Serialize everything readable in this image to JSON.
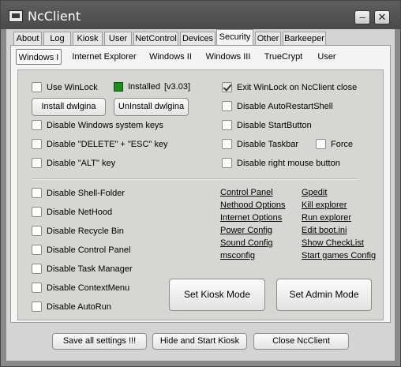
{
  "window": {
    "title": "NcClient",
    "minimize": "–",
    "close": "✕"
  },
  "tabs": [
    "About",
    "Log",
    "Kiosk",
    "User",
    "NetControl",
    "Devices",
    "Security",
    "Other",
    "Barkeeper"
  ],
  "subtabs": [
    "Windows I",
    "Internet Explorer",
    "Windows II",
    "Windows III",
    "TrueCrypt",
    "User"
  ],
  "winlock": {
    "use_label": "Use WinLock",
    "status_label": "Installed",
    "version": "[v3.03]",
    "status_color": "#1f8a1f",
    "install_button": "Install dwlgina",
    "uninstall_button": "UnInstall dwlgina",
    "exit_label": "Exit WinLock on NcClient close"
  },
  "left_options": [
    "Disable Windows system keys",
    "Disable \"DELETE\" + \"ESC\" key",
    "Disable \"ALT\" key"
  ],
  "right_options": {
    "auto_restart": "Disable AutoRestartShell",
    "start_button": "Disable StartButton",
    "taskbar": "Disable Taskbar",
    "force": "Force",
    "right_mouse": "Disable right mouse button"
  },
  "lower_options": [
    "Disable Shell-Folder",
    "Disable NetHood",
    "Disable Recycle Bin",
    "Disable Control Panel",
    "Disable Task Manager",
    "Disable ContextMenu",
    "Disable AutoRun"
  ],
  "links_col1": [
    "Control Panel",
    "Nethood Options",
    "Internet Options",
    "Power Config",
    "Sound Config",
    "msconfig"
  ],
  "links_col2": [
    "Gpedit",
    "Kill explorer",
    "Run explorer",
    "Edit boot.ini",
    "Show CheckList",
    "Start games Config"
  ],
  "mode_buttons": {
    "kiosk": "Set Kiosk Mode",
    "admin": "Set Admin Mode"
  },
  "footer": {
    "save": "Save all settings !!!",
    "hide": "Hide and Start Kiosk",
    "close": "Close NcClient"
  }
}
